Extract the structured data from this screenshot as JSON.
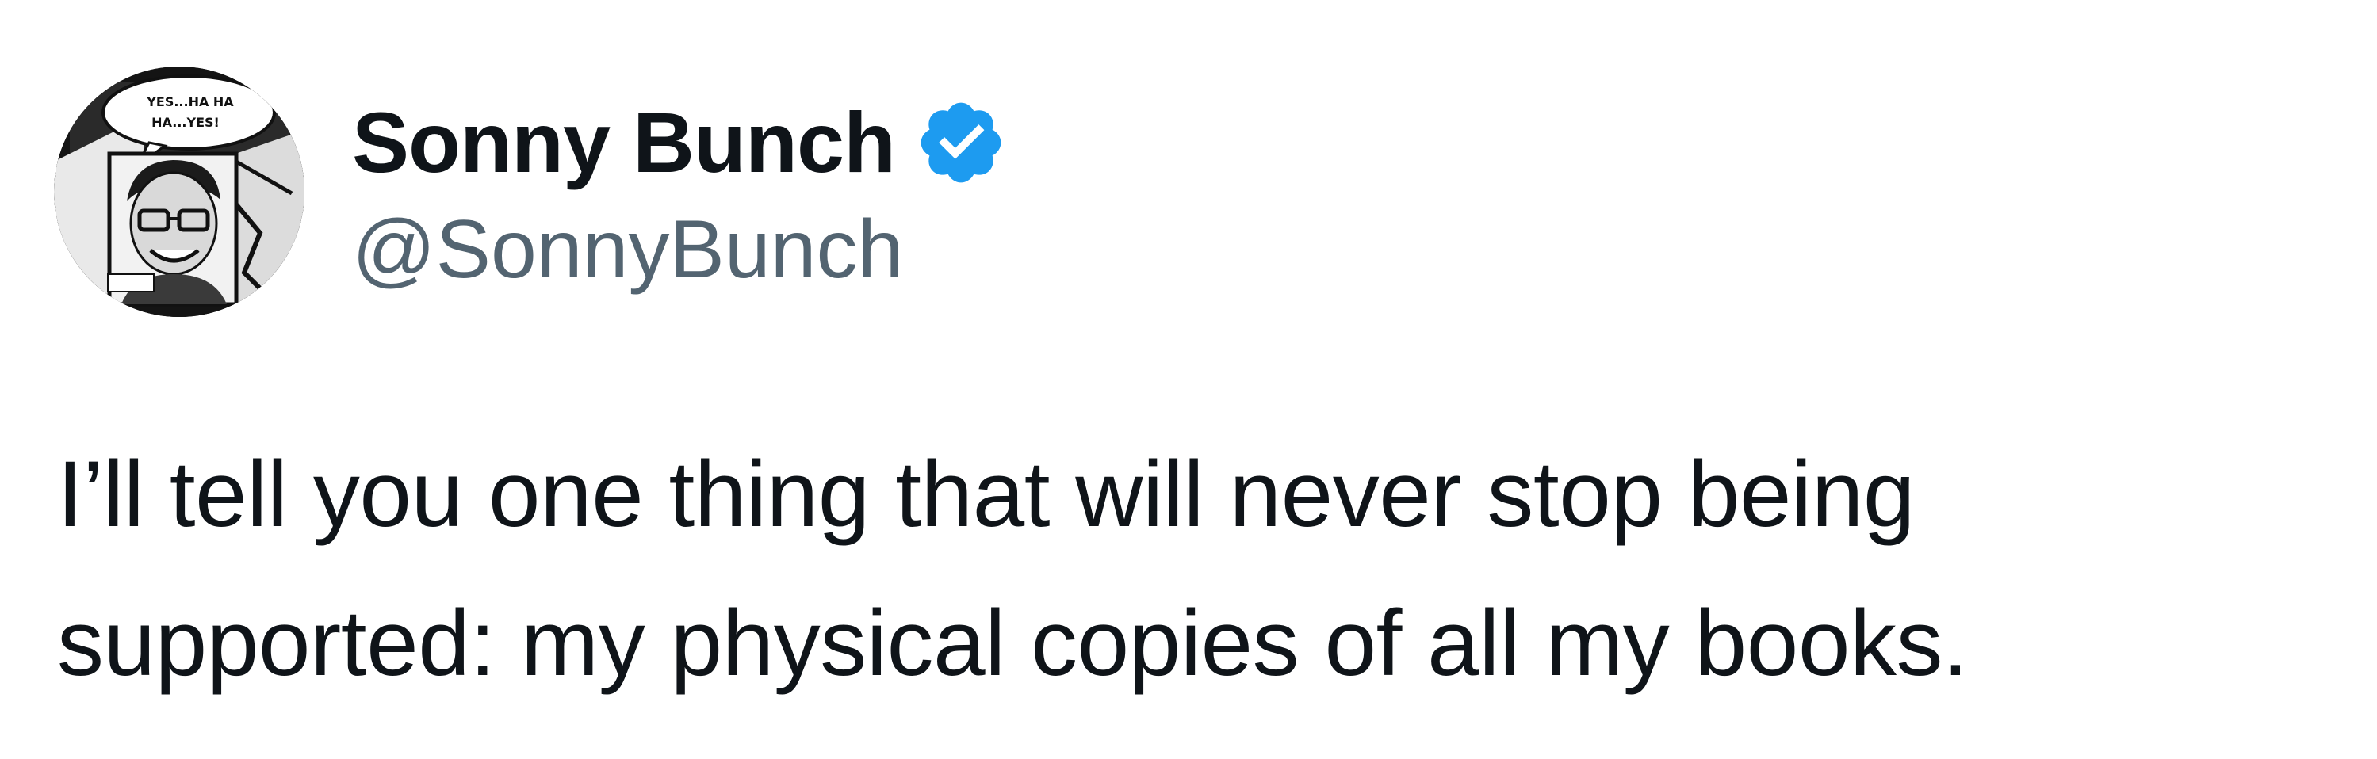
{
  "author": {
    "display_name": "Sonny Bunch",
    "handle": "@SonnyBunch",
    "verified": true,
    "verified_color": "#1d9bf0",
    "avatar_icon": "comic-portrait-avatar",
    "avatar_text_line1": "YES...HA HA",
    "avatar_text_line2": "HA...YES!"
  },
  "tweet": {
    "text_lines": [
      "I’ll tell you one thing that will never stop being",
      "supported: my physical copies of all my books."
    ]
  },
  "colors": {
    "text": "#0f1419",
    "secondary": "#536471",
    "background": "#ffffff"
  }
}
